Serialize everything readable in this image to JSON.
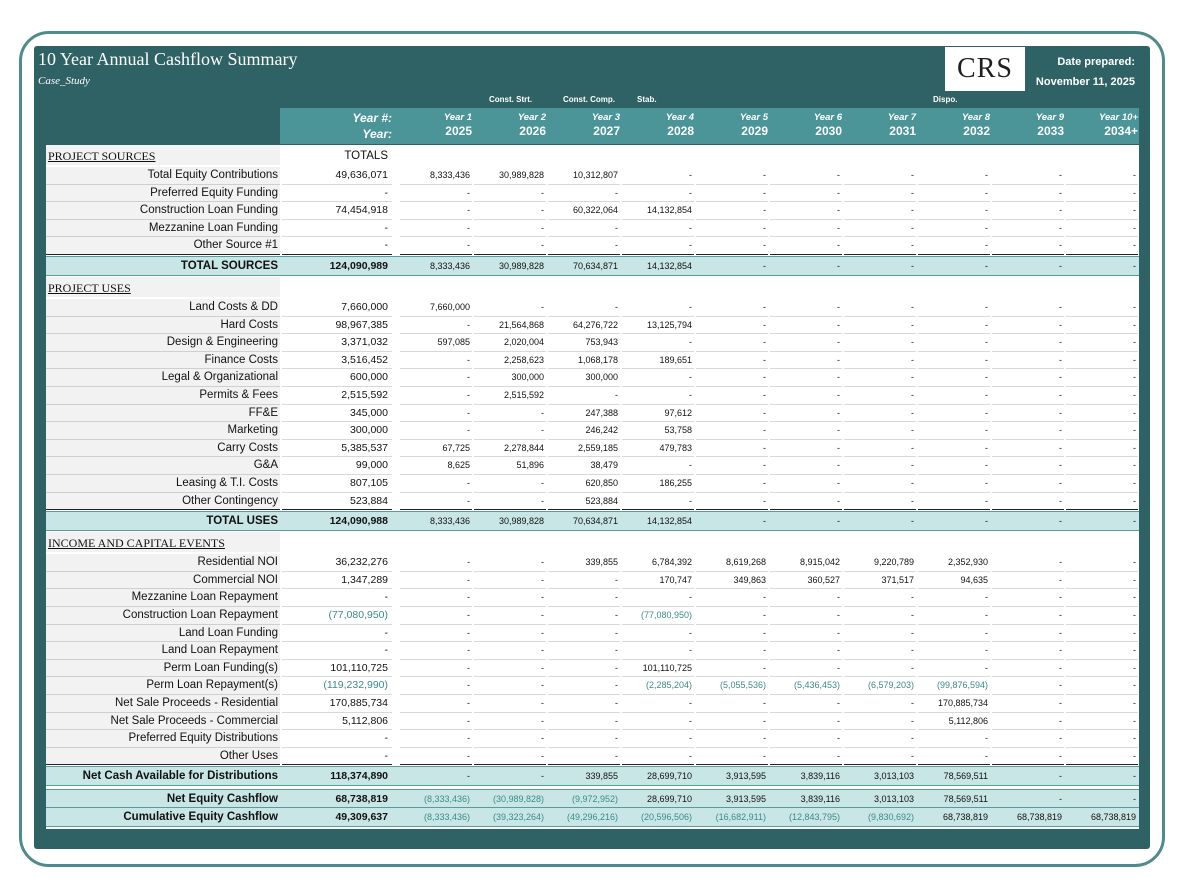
{
  "header": {
    "title": "10 Year Annual Cashflow Summary",
    "subtitle": "Case_Study",
    "logo_text": "CRS",
    "date_label": "Date prepared:",
    "date_value": "November 11, 2025"
  },
  "phases": [
    {
      "label": "Const. Strt.",
      "col": 1
    },
    {
      "label": "Const. Comp.",
      "col": 2
    },
    {
      "label": "Stab.",
      "col": 3
    },
    {
      "label": "Dispo.",
      "col": 7
    }
  ],
  "year_header": {
    "yearnum_label": "Year #:",
    "year_label": "Year:",
    "totals_label": "TOTALS",
    "columns": [
      {
        "num": "Year 1",
        "year": "2025"
      },
      {
        "num": "Year 2",
        "year": "2026"
      },
      {
        "num": "Year 3",
        "year": "2027"
      },
      {
        "num": "Year 4",
        "year": "2028"
      },
      {
        "num": "Year 5",
        "year": "2029"
      },
      {
        "num": "Year 6",
        "year": "2030"
      },
      {
        "num": "Year 7",
        "year": "2031"
      },
      {
        "num": "Year 8",
        "year": "2032"
      },
      {
        "num": "Year 9",
        "year": "2033"
      },
      {
        "num": "Year 10+",
        "year": "2034+"
      }
    ]
  },
  "sections": [
    {
      "title": "PROJECT SOURCES",
      "rows": [
        {
          "label": "Total Equity Contributions",
          "total": "49,636,071",
          "values": [
            "8,333,436",
            "30,989,828",
            "10,312,807",
            "-",
            "-",
            "-",
            "-",
            "-",
            "-",
            "-"
          ]
        },
        {
          "label": "Preferred Equity Funding",
          "total": "-",
          "values": [
            "-",
            "-",
            "-",
            "-",
            "-",
            "-",
            "-",
            "-",
            "-",
            "-"
          ]
        },
        {
          "label": "Construction Loan Funding",
          "total": "74,454,918",
          "values": [
            "-",
            "-",
            "60,322,064",
            "14,132,854",
            "-",
            "-",
            "-",
            "-",
            "-",
            "-"
          ]
        },
        {
          "label": "Mezzanine Loan Funding",
          "total": "-",
          "values": [
            "-",
            "-",
            "-",
            "-",
            "-",
            "-",
            "-",
            "-",
            "-",
            "-"
          ]
        },
        {
          "label": "Other Source #1",
          "total": "-",
          "values": [
            "-",
            "-",
            "-",
            "-",
            "-",
            "-",
            "-",
            "-",
            "-",
            "-"
          ]
        }
      ],
      "total_row": {
        "label": "TOTAL SOURCES",
        "total": "124,090,989",
        "values": [
          "8,333,436",
          "30,989,828",
          "70,634,871",
          "14,132,854",
          "-",
          "-",
          "-",
          "-",
          "-",
          "-"
        ]
      }
    },
    {
      "title": "PROJECT USES",
      "rows": [
        {
          "label": "Land Costs & DD",
          "total": "7,660,000",
          "values": [
            "7,660,000",
            "-",
            "-",
            "-",
            "-",
            "-",
            "-",
            "-",
            "-",
            "-"
          ]
        },
        {
          "label": "Hard Costs",
          "total": "98,967,385",
          "values": [
            "-",
            "21,564,868",
            "64,276,722",
            "13,125,794",
            "-",
            "-",
            "-",
            "-",
            "-",
            "-"
          ]
        },
        {
          "label": "Design & Engineering",
          "total": "3,371,032",
          "values": [
            "597,085",
            "2,020,004",
            "753,943",
            "-",
            "-",
            "-",
            "-",
            "-",
            "-",
            "-"
          ]
        },
        {
          "label": "Finance Costs",
          "total": "3,516,452",
          "values": [
            "-",
            "2,258,623",
            "1,068,178",
            "189,651",
            "-",
            "-",
            "-",
            "-",
            "-",
            "-"
          ]
        },
        {
          "label": "Legal & Organizational",
          "total": "600,000",
          "values": [
            "-",
            "300,000",
            "300,000",
            "-",
            "-",
            "-",
            "-",
            "-",
            "-",
            "-"
          ]
        },
        {
          "label": "Permits & Fees",
          "total": "2,515,592",
          "values": [
            "-",
            "2,515,592",
            "-",
            "-",
            "-",
            "-",
            "-",
            "-",
            "-",
            "-"
          ]
        },
        {
          "label": "FF&E",
          "total": "345,000",
          "values": [
            "-",
            "-",
            "247,388",
            "97,612",
            "-",
            "-",
            "-",
            "-",
            "-",
            "-"
          ]
        },
        {
          "label": "Marketing",
          "total": "300,000",
          "values": [
            "-",
            "-",
            "246,242",
            "53,758",
            "-",
            "-",
            "-",
            "-",
            "-",
            "-"
          ]
        },
        {
          "label": "Carry Costs",
          "total": "5,385,537",
          "values": [
            "67,725",
            "2,278,844",
            "2,559,185",
            "479,783",
            "-",
            "-",
            "-",
            "-",
            "-",
            "-"
          ]
        },
        {
          "label": "G&A",
          "total": "99,000",
          "values": [
            "8,625",
            "51,896",
            "38,479",
            "-",
            "-",
            "-",
            "-",
            "-",
            "-",
            "-"
          ]
        },
        {
          "label": "Leasing & T.I. Costs",
          "total": "807,105",
          "values": [
            "-",
            "-",
            "620,850",
            "186,255",
            "-",
            "-",
            "-",
            "-",
            "-",
            "-"
          ]
        },
        {
          "label": "Other Contingency",
          "total": "523,884",
          "values": [
            "-",
            "-",
            "523,884",
            "-",
            "-",
            "-",
            "-",
            "-",
            "-",
            "-"
          ]
        }
      ],
      "total_row": {
        "label": "TOTAL USES",
        "total": "124,090,988",
        "values": [
          "8,333,436",
          "30,989,828",
          "70,634,871",
          "14,132,854",
          "-",
          "-",
          "-",
          "-",
          "-",
          "-"
        ]
      }
    },
    {
      "title": "INCOME AND CAPITAL EVENTS",
      "rows": [
        {
          "label": "Residential NOI",
          "total": "36,232,276",
          "values": [
            "-",
            "-",
            "339,855",
            "6,784,392",
            "8,619,268",
            "8,915,042",
            "9,220,789",
            "2,352,930",
            "-",
            "-"
          ]
        },
        {
          "label": "Commercial NOI",
          "total": "1,347,289",
          "values": [
            "-",
            "-",
            "-",
            "170,747",
            "349,863",
            "360,527",
            "371,517",
            "94,635",
            "-",
            "-"
          ]
        },
        {
          "label": "Mezzanine Loan Repayment",
          "total": "-",
          "values": [
            "-",
            "-",
            "-",
            "-",
            "-",
            "-",
            "-",
            "-",
            "-",
            "-"
          ]
        },
        {
          "label": "Construction Loan Repayment",
          "total": "(77,080,950)",
          "values": [
            "-",
            "-",
            "-",
            "(77,080,950)",
            "-",
            "-",
            "-",
            "-",
            "-",
            "-"
          ]
        },
        {
          "label": "Land Loan Funding",
          "total": "-",
          "values": [
            "-",
            "-",
            "-",
            "-",
            "-",
            "-",
            "-",
            "-",
            "-",
            "-"
          ]
        },
        {
          "label": "Land Loan Repayment",
          "total": "-",
          "values": [
            "-",
            "-",
            "-",
            "-",
            "-",
            "-",
            "-",
            "-",
            "-",
            "-"
          ]
        },
        {
          "label": "Perm Loan Funding(s)",
          "total": "101,110,725",
          "values": [
            "-",
            "-",
            "-",
            "101,110,725",
            "-",
            "-",
            "-",
            "-",
            "-",
            "-"
          ]
        },
        {
          "label": "Perm Loan Repayment(s)",
          "total": "(119,232,990)",
          "values": [
            "-",
            "-",
            "-",
            "(2,285,204)",
            "(5,055,536)",
            "(5,436,453)",
            "(6,579,203)",
            "(99,876,594)",
            "-",
            "-"
          ]
        },
        {
          "label": "Net Sale Proceeds - Residential",
          "total": "170,885,734",
          "values": [
            "-",
            "-",
            "-",
            "-",
            "-",
            "-",
            "-",
            "170,885,734",
            "-",
            "-"
          ]
        },
        {
          "label": "Net Sale Proceeds - Commercial",
          "total": "5,112,806",
          "values": [
            "-",
            "-",
            "-",
            "-",
            "-",
            "-",
            "-",
            "5,112,806",
            "-",
            "-"
          ]
        },
        {
          "label": "Preferred Equity Distributions",
          "total": "-",
          "values": [
            "-",
            "-",
            "-",
            "-",
            "-",
            "-",
            "-",
            "-",
            "-",
            "-"
          ]
        },
        {
          "label": "Other Uses",
          "total": "-",
          "values": [
            "-",
            "-",
            "-",
            "-",
            "-",
            "-",
            "-",
            "-",
            "-",
            "-"
          ]
        }
      ],
      "total_row": {
        "label": "Net Cash Available for Distributions",
        "total": "118,374,890",
        "values": [
          "-",
          "-",
          "339,855",
          "28,699,710",
          "3,913,595",
          "3,839,116",
          "3,013,103",
          "78,569,511",
          "-",
          "-"
        ]
      }
    }
  ],
  "summary_rows": [
    {
      "label": "Net Equity Cashflow",
      "total": "68,738,819",
      "values": [
        "(8,333,436)",
        "(30,989,828)",
        "(9,972,952)",
        "28,699,710",
        "3,913,595",
        "3,839,116",
        "3,013,103",
        "78,569,511",
        "-",
        "-"
      ]
    },
    {
      "label": "Cumulative Equity Cashflow",
      "total": "49,309,637",
      "values": [
        "(8,333,436)",
        "(39,323,264)",
        "(49,296,216)",
        "(20,596,506)",
        "(16,682,911)",
        "(12,843,795)",
        "(9,830,692)",
        "68,738,819",
        "68,738,819",
        "68,738,819"
      ]
    }
  ],
  "colors": {
    "panel": "#2f6264",
    "header_band": "#4b9497",
    "total_band": "#c9e6e6",
    "negative": "#3c8a8a"
  }
}
